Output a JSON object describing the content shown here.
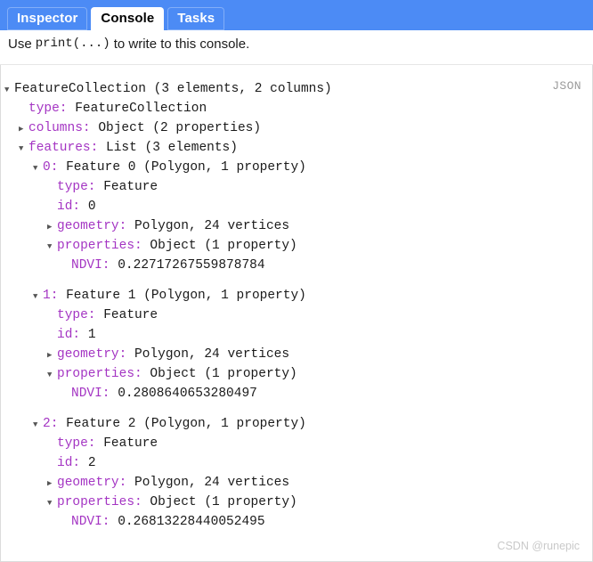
{
  "tabs": [
    {
      "label": "Inspector",
      "active": false
    },
    {
      "label": "Console",
      "active": true
    },
    {
      "label": "Tasks",
      "active": false
    }
  ],
  "hint": {
    "prefix": "Use",
    "code": "print(...)",
    "suffix": "to write to this console."
  },
  "console": {
    "format_tag": "JSON"
  },
  "tree": [
    {
      "indent": 0,
      "twisty": "expanded",
      "key": "",
      "value": "FeatureCollection (3 elements, 2 columns)"
    },
    {
      "indent": 1,
      "twisty": "none",
      "key": "type:",
      "value": "FeatureCollection"
    },
    {
      "indent": 1,
      "twisty": "collapsed",
      "key": "columns:",
      "value": "Object (2 properties)"
    },
    {
      "indent": 1,
      "twisty": "expanded",
      "key": "features:",
      "value": "List (3 elements)"
    },
    {
      "indent": 2,
      "twisty": "expanded",
      "key": "0:",
      "value": "Feature 0 (Polygon, 1 property)"
    },
    {
      "indent": 3,
      "twisty": "none",
      "key": "type:",
      "value": "Feature"
    },
    {
      "indent": 3,
      "twisty": "none",
      "key": "id:",
      "value": "0"
    },
    {
      "indent": 3,
      "twisty": "collapsed",
      "key": "geometry:",
      "value": "Polygon, 24 vertices"
    },
    {
      "indent": 3,
      "twisty": "expanded",
      "key": "properties:",
      "value": "Object (1 property)"
    },
    {
      "indent": 4,
      "twisty": "none",
      "key": "NDVI:",
      "value": "0.22717267559878784"
    },
    {
      "indent": 0,
      "twisty": "spacer",
      "key": "",
      "value": ""
    },
    {
      "indent": 2,
      "twisty": "expanded",
      "key": "1:",
      "value": "Feature 1 (Polygon, 1 property)"
    },
    {
      "indent": 3,
      "twisty": "none",
      "key": "type:",
      "value": "Feature"
    },
    {
      "indent": 3,
      "twisty": "none",
      "key": "id:",
      "value": "1"
    },
    {
      "indent": 3,
      "twisty": "collapsed",
      "key": "geometry:",
      "value": "Polygon, 24 vertices"
    },
    {
      "indent": 3,
      "twisty": "expanded",
      "key": "properties:",
      "value": "Object (1 property)"
    },
    {
      "indent": 4,
      "twisty": "none",
      "key": "NDVI:",
      "value": "0.2808640653280497"
    },
    {
      "indent": 0,
      "twisty": "spacer",
      "key": "",
      "value": ""
    },
    {
      "indent": 2,
      "twisty": "expanded",
      "key": "2:",
      "value": "Feature 2 (Polygon, 1 property)"
    },
    {
      "indent": 3,
      "twisty": "none",
      "key": "type:",
      "value": "Feature"
    },
    {
      "indent": 3,
      "twisty": "none",
      "key": "id:",
      "value": "2"
    },
    {
      "indent": 3,
      "twisty": "collapsed",
      "key": "geometry:",
      "value": "Polygon, 24 vertices"
    },
    {
      "indent": 3,
      "twisty": "expanded",
      "key": "properties:",
      "value": "Object (1 property)"
    },
    {
      "indent": 4,
      "twisty": "none",
      "key": "NDVI:",
      "value": "0.26813228440052495"
    }
  ],
  "watermark": "CSDN @runepic",
  "colors": {
    "tabbar_blue": "#4c8bf5",
    "key_purple": "#a435c3",
    "value_dark": "#1a1a1a",
    "tag_gray": "#9a9a9a",
    "watermark_gray": "#c9c9c9"
  }
}
